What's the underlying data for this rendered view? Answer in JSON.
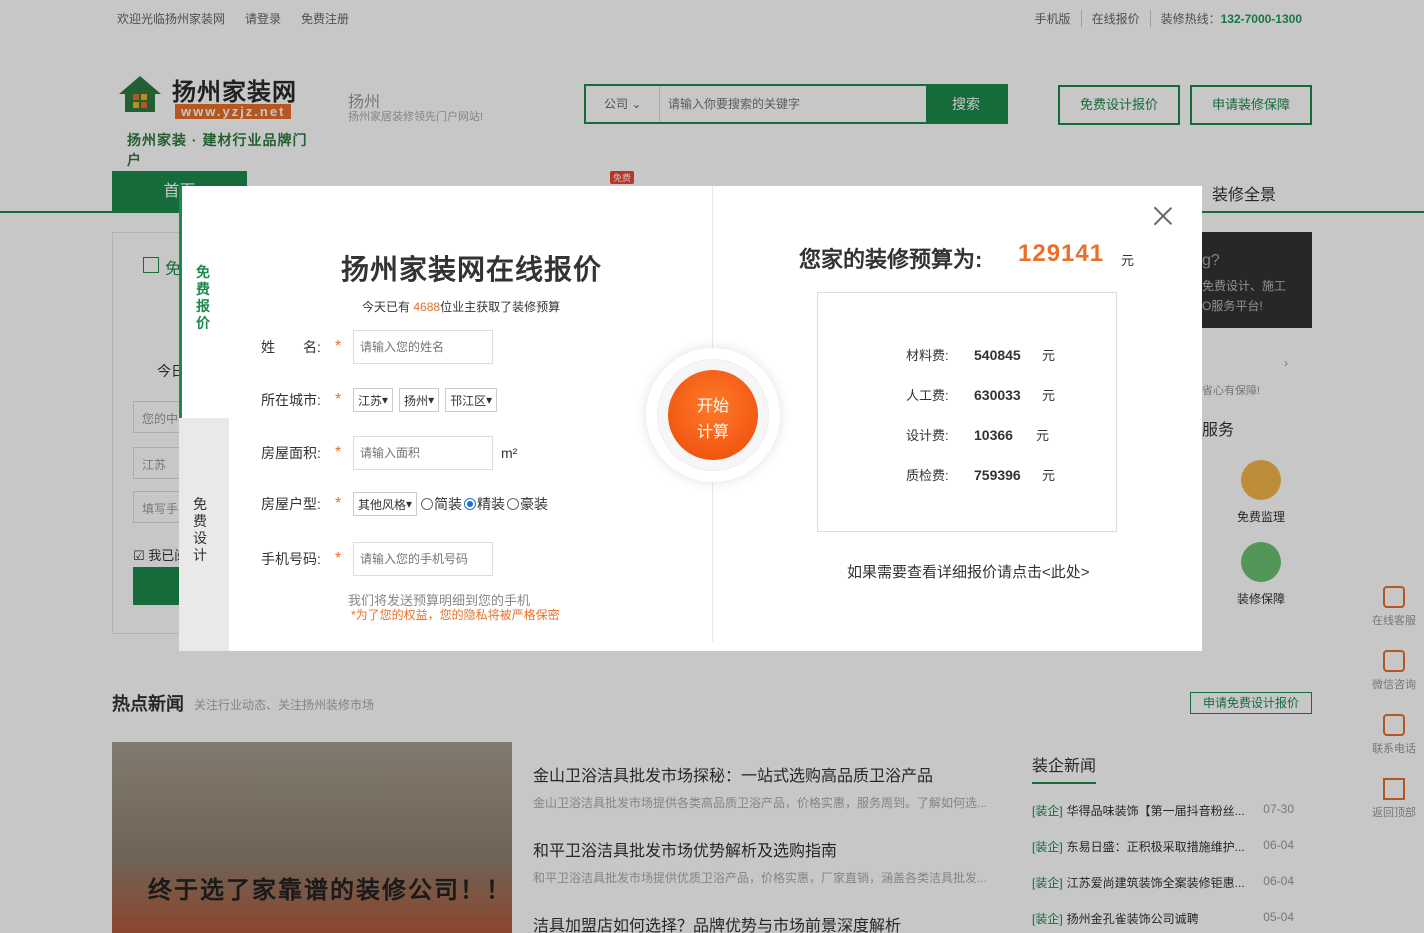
{
  "topbar": {
    "welcome": "欢迎光临扬州家装网",
    "login": "请登录",
    "register": "免费注册",
    "mobile": "手机版",
    "online_quote": "在线报价",
    "hotline_label": "装修热线：",
    "hotline": "132-7000-1300"
  },
  "header": {
    "logo_name": "扬州家装网",
    "logo_url": "www.yzjz.net",
    "logo_slogan": "扬州家装 · 建材行业品牌门户",
    "city": "扬州",
    "city_sub": "扬州家居装修领先门户网站!",
    "search_type": "公司",
    "search_placeholder": "请输入你要搜索的关键字",
    "search_button": "搜索",
    "btn_design": "免费设计报价",
    "btn_guarantee": "申请装修保障"
  },
  "nav": {
    "home": "首页",
    "items": [
      "装修全景"
    ],
    "badge": "免费"
  },
  "right_panel": {
    "title": "g?",
    "sub1": "免费设计、施工",
    "sub2": "O服务平台!",
    "assure": "省心有保障!",
    "service_title": "服务",
    "svc1": "免费监理",
    "svc2": "装修保障"
  },
  "floatbar": [
    "在线客服",
    "微信咨询",
    "联系电话",
    "返回顶部"
  ],
  "left_panel": {
    "label1": "免",
    "today": "今日",
    "input1": "您的中",
    "input2": "江苏",
    "input3": "填写手",
    "agree": "我已阅"
  },
  "news": {
    "title": "热点新闻",
    "subtitle": "关注行业动态、关注扬州装修市场",
    "apply_btn": "申请免费设计报价",
    "image_caption": "终于选了家靠谱的装修公司！！",
    "items": [
      {
        "title": "金山卫浴洁具批发市场探秘：一站式选购高品质卫浴产品",
        "desc": "金山卫浴洁具批发市场提供各类高品质卫浴产品，价格实惠，服务周到。了解如何选..."
      },
      {
        "title": "和平卫浴洁具批发市场优势解析及选购指南",
        "desc": "和平卫浴洁具批发市场提供优质卫浴产品，价格实惠，厂家直销，涵盖各类洁具批发..."
      },
      {
        "title": "洁具加盟店如何选择？品牌优势与市场前景深度解析",
        "desc": ""
      }
    ],
    "corp_title": "装企新闻",
    "corp_items": [
      {
        "tag": "[装企]",
        "title": "华得品味装饰【第一届抖音粉丝...",
        "date": "07-30"
      },
      {
        "tag": "[装企]",
        "title": "东易日盛：正积极采取措施维护...",
        "date": "06-04"
      },
      {
        "tag": "[装企]",
        "title": "江苏爱尚建筑装饰全案装修钜惠...",
        "date": "06-04"
      },
      {
        "tag": "[装企]",
        "title": "扬州金孔雀装饰公司诚聘",
        "date": "05-04"
      }
    ]
  },
  "modal": {
    "tab_quote": "免费报价",
    "tab_design": "免费设计",
    "title": "扬州家装网在线报价",
    "sub_prefix": "今天已有",
    "sub_count": "4688",
    "sub_suffix": "位业主获取了装修预算",
    "name_label": "姓　　名:",
    "name_placeholder": "请输入您的姓名",
    "city_label": "所在城市:",
    "province": "江苏",
    "city": "扬州",
    "district": "邗江区",
    "area_label": "房屋面积:",
    "area_placeholder": "请输入面积",
    "area_unit": "m²",
    "type_label": "房屋户型:",
    "type_value": "其他风格",
    "opt_simple": "简装",
    "opt_fine": "精装",
    "opt_luxury": "豪装",
    "phone_label": "手机号码:",
    "phone_placeholder": "请输入您的手机号码",
    "note1": "我们将发送预算明细到您的手机",
    "note2": "*为了您的权益，您的隐私将被严格保密",
    "calc_line1": "开始",
    "calc_line2": "计算",
    "result_title": "您家的装修预算为:",
    "result_total": "129141",
    "result_unit": "元",
    "costs": [
      {
        "label": "材料费:",
        "value": "540845",
        "unit": "元"
      },
      {
        "label": "人工费:",
        "value": "630033",
        "unit": "元"
      },
      {
        "label": "设计费:",
        "value": "10366",
        "unit": "元"
      },
      {
        "label": "质检费:",
        "value": "759396",
        "unit": "元"
      }
    ],
    "detail_link": "如果需要查看详细报价请点击<此处>"
  },
  "colors": {
    "brand_green": "#1d8a4c",
    "accent_orange": "#e8702a"
  }
}
